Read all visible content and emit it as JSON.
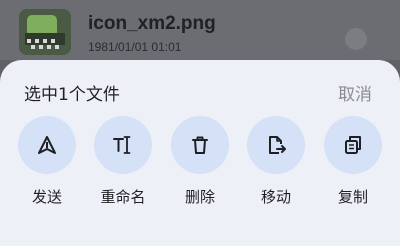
{
  "file": {
    "name": "icon_xm2.png",
    "date": "1981/01/01 01:01"
  },
  "sheet": {
    "title": "选中1个文件",
    "cancel_label": "取消",
    "actions": [
      {
        "label": "发送",
        "icon": "send-icon"
      },
      {
        "label": "重命名",
        "icon": "rename-icon"
      },
      {
        "label": "删除",
        "icon": "delete-icon"
      },
      {
        "label": "移动",
        "icon": "move-icon"
      },
      {
        "label": "复制",
        "icon": "copy-icon"
      }
    ]
  },
  "colors": {
    "sheet_background": "#eef0f8",
    "action_circle": "#d5e1f7",
    "scrim": "#5f6166",
    "muted_text": "#8a8c90"
  }
}
